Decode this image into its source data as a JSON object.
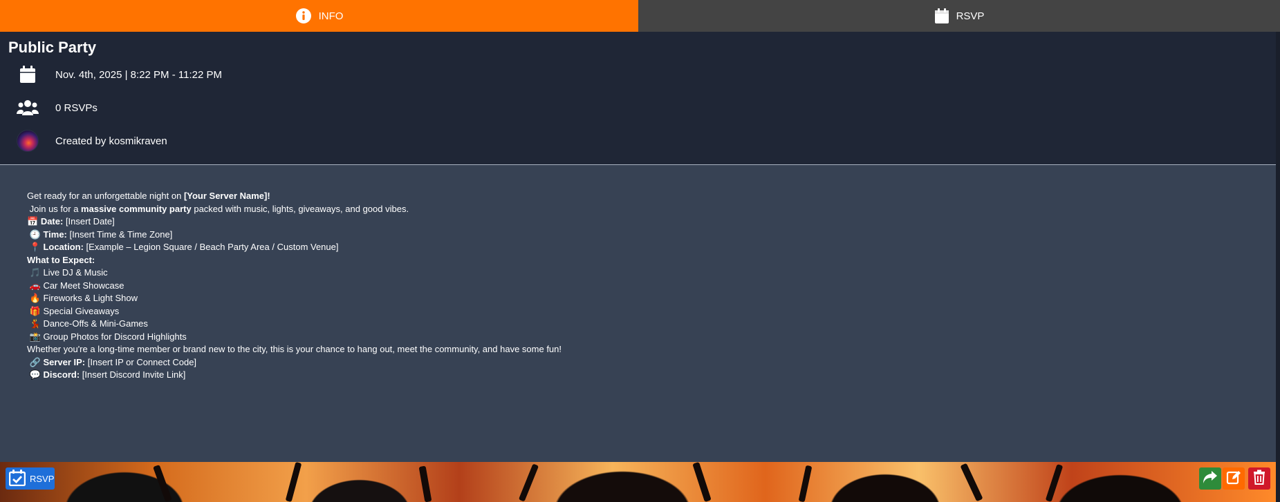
{
  "tabs": [
    {
      "label": "INFO",
      "icon": "info-circle-icon",
      "active": true
    },
    {
      "label": "RSVP",
      "icon": "calendar-icon",
      "active": false
    }
  ],
  "colors": {
    "accent": "#ff7300",
    "header_bg": "#1f2636",
    "description_bg": "#374254",
    "rsvp_button": "#1e6fd9",
    "share_button": "#2e8b3a",
    "edit_button": "#ff6a00",
    "delete_button": "#d0192a"
  },
  "event": {
    "title": "Public Party",
    "date_time": "Nov. 4th, 2025 | 8:22 PM - 11:22 PM",
    "rsvp_count": "0 RSVPs",
    "created_by": "Created by kosmikraven"
  },
  "description": {
    "line1_a": "Get ready for an unforgettable night on ",
    "line1_b": "[Your Server Name]",
    "line1_c": "!",
    "line2_a": " Join us for a ",
    "line2_b": "massive community party",
    "line2_c": " packed with music, lights, giveaways, and good vibes.",
    "date_emoji": "📅",
    "date_label": "Date:",
    "date_value": " [Insert Date]",
    "time_emoji": "🕘",
    "time_label": "Time:",
    "time_value": " [Insert Time & Time Zone]",
    "location_emoji": "📍",
    "location_label": "Location:",
    "location_value": " [Example – Legion Square / Beach Party Area / Custom Venue]",
    "expect_heading": "What to Expect:",
    "expect_items": [
      {
        "emoji": "🎵",
        "text": "Live DJ & Music"
      },
      {
        "emoji": "🚗",
        "text": "Car Meet Showcase"
      },
      {
        "emoji": "🔥",
        "text": "Fireworks & Light Show"
      },
      {
        "emoji": "🎁",
        "text": "Special Giveaways"
      },
      {
        "emoji": "💃",
        "text": "Dance-Offs & Mini-Games"
      },
      {
        "emoji": "📸",
        "text": "Group Photos for Discord Highlights"
      }
    ],
    "closing": "Whether you're a long-time member or brand new to the city, this is your chance to hang out, meet the community, and have some fun!",
    "server_emoji": "🔗",
    "server_label": "Server IP:",
    "server_value": " [Insert IP or Connect Code]",
    "discord_emoji": "💬",
    "discord_label": "Discord:",
    "discord_value": " [Insert Discord Invite Link]"
  },
  "footer": {
    "rsvp_button_label": "RSVP",
    "actions": [
      "share-icon",
      "edit-icon",
      "trash-icon"
    ]
  }
}
